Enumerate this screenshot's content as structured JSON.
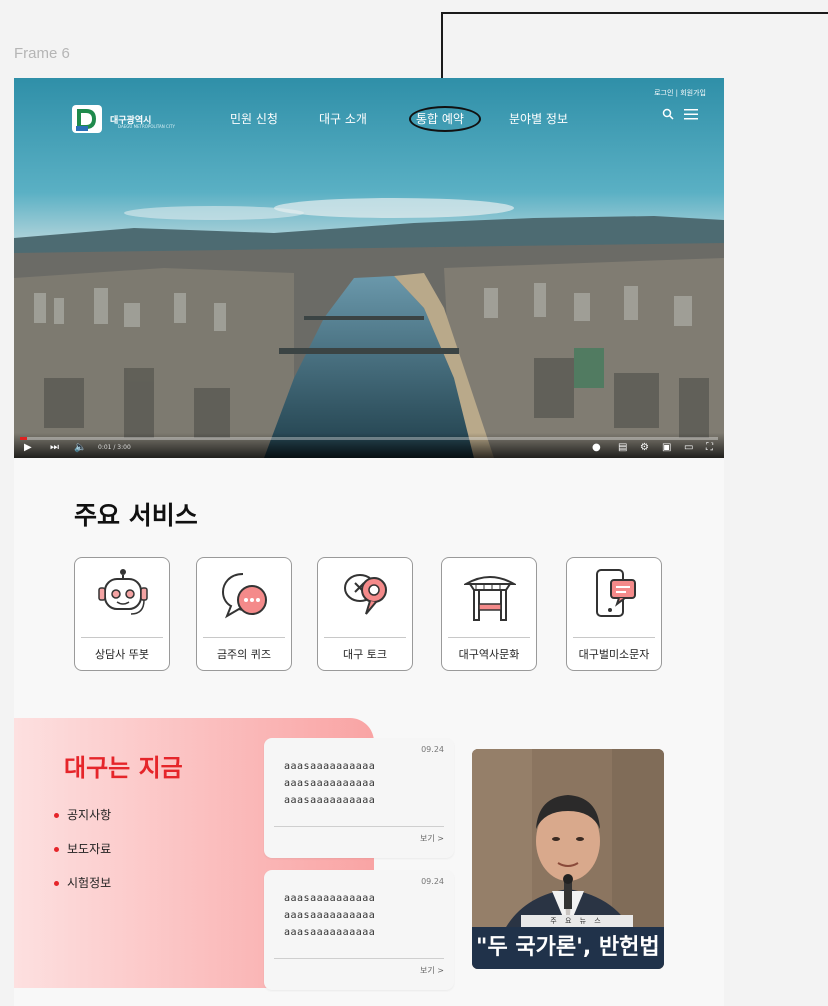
{
  "frame": {
    "label": "Frame 6"
  },
  "header": {
    "logo_text": "대구광역시",
    "logo_sub": "DAEGU METROPOLITAN CITY",
    "menu": [
      "민원 신청",
      "대구 소개",
      "통합 예약",
      "분야별 정보"
    ],
    "login": "로그인 | 회원가입",
    "icons": [
      "search-icon",
      "hamburger-menu-icon"
    ]
  },
  "video": {
    "time": "0:01 / 3:00",
    "progress": 0.01
  },
  "services": {
    "title": "주요 서비스",
    "items": [
      {
        "label": "상담사 뚜봇",
        "icon": "chatbot-robot-icon"
      },
      {
        "label": "금주의 퀴즈",
        "icon": "quiz-chat-bubble-icon"
      },
      {
        "label": "대구 토크",
        "icon": "talk-bubbles-icon"
      },
      {
        "label": "대구역사문화",
        "icon": "traditional-gate-icon"
      },
      {
        "label": "대구벌미소문자",
        "icon": "mobile-message-icon"
      }
    ]
  },
  "now": {
    "title": "대구는 지금",
    "items": [
      "공지사항",
      "보도자료",
      "시험정보"
    ]
  },
  "cards": [
    {
      "date": "09.24",
      "lines": [
        "aaasaaaaaaaaaa",
        "aaasaaaaaaaaaa",
        "aaasaaaaaaaaaa"
      ],
      "more": "보기 >"
    },
    {
      "date": "09.24",
      "lines": [
        "aaasaaaaaaaaaa",
        "aaasaaaaaaaaaa",
        "aaasaaaaaaaaaa"
      ],
      "more": "보기 >"
    }
  ],
  "photo": {
    "label": "주 요 뉴 스",
    "headline": "\"두 국가론', 반헌법"
  },
  "colors": {
    "accent": "#e5252a",
    "caption_bg": "#20324a"
  }
}
